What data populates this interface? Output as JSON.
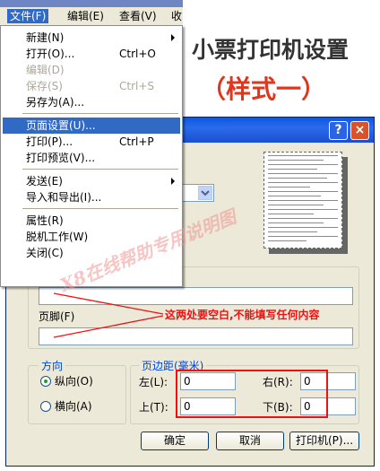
{
  "menubar": {
    "items": [
      {
        "label": "文件(F)"
      },
      {
        "label": "编辑(E)"
      },
      {
        "label": "查看(V)"
      },
      {
        "label": "收"
      }
    ]
  },
  "file_menu": {
    "items": [
      {
        "label": "新建(N)",
        "shortcut": ""
      },
      {
        "label": "打开(O)...",
        "shortcut": "Ctrl+O"
      },
      {
        "label": "编辑(D)",
        "shortcut": ""
      },
      {
        "label": "保存(S)",
        "shortcut": "Ctrl+S"
      },
      {
        "label": "另存为(A)...",
        "shortcut": ""
      },
      {
        "label": "页面设置(U)...",
        "shortcut": ""
      },
      {
        "label": "打印(P)...",
        "shortcut": "Ctrl+P"
      },
      {
        "label": "打印预览(V)...",
        "shortcut": ""
      },
      {
        "label": "发送(E)",
        "shortcut": ""
      },
      {
        "label": "导入和导出(I)...",
        "shortcut": ""
      },
      {
        "label": "属性(R)",
        "shortcut": ""
      },
      {
        "label": "脱机工作(W)",
        "shortcut": ""
      },
      {
        "label": "关闭(C)",
        "shortcut": ""
      }
    ],
    "highlighted": "页面设置(U)..."
  },
  "heading": {
    "title": "小票打印机设置",
    "subtitle": "（样式一）"
  },
  "dialog": {
    "help_label": "?",
    "close_label": "×",
    "footer_label": "页脚(F)",
    "header_value": "",
    "footer_value": "",
    "orientation": {
      "title": "方向",
      "portrait": "纵向(O)",
      "landscape": "横向(A)",
      "selected": "portrait"
    },
    "margins": {
      "title": "页边距(毫米)",
      "left_label": "左(L):",
      "left_value": "0",
      "right_label": "右(R):",
      "right_value": "0",
      "top_label": "上(T):",
      "top_value": "0",
      "bottom_label": "下(B):",
      "bottom_value": "0"
    },
    "buttons": {
      "ok": "确定",
      "cancel": "取消",
      "printer": "打印机(P)..."
    }
  },
  "annotation": {
    "text": "这两处要空白,不能填写任何内容"
  },
  "watermark": {
    "text": "X8在线帮助专用说明图"
  },
  "colors": {
    "accent": "#316ac5",
    "annotation": "#ee1111",
    "title_bar": "#0a58e4"
  }
}
